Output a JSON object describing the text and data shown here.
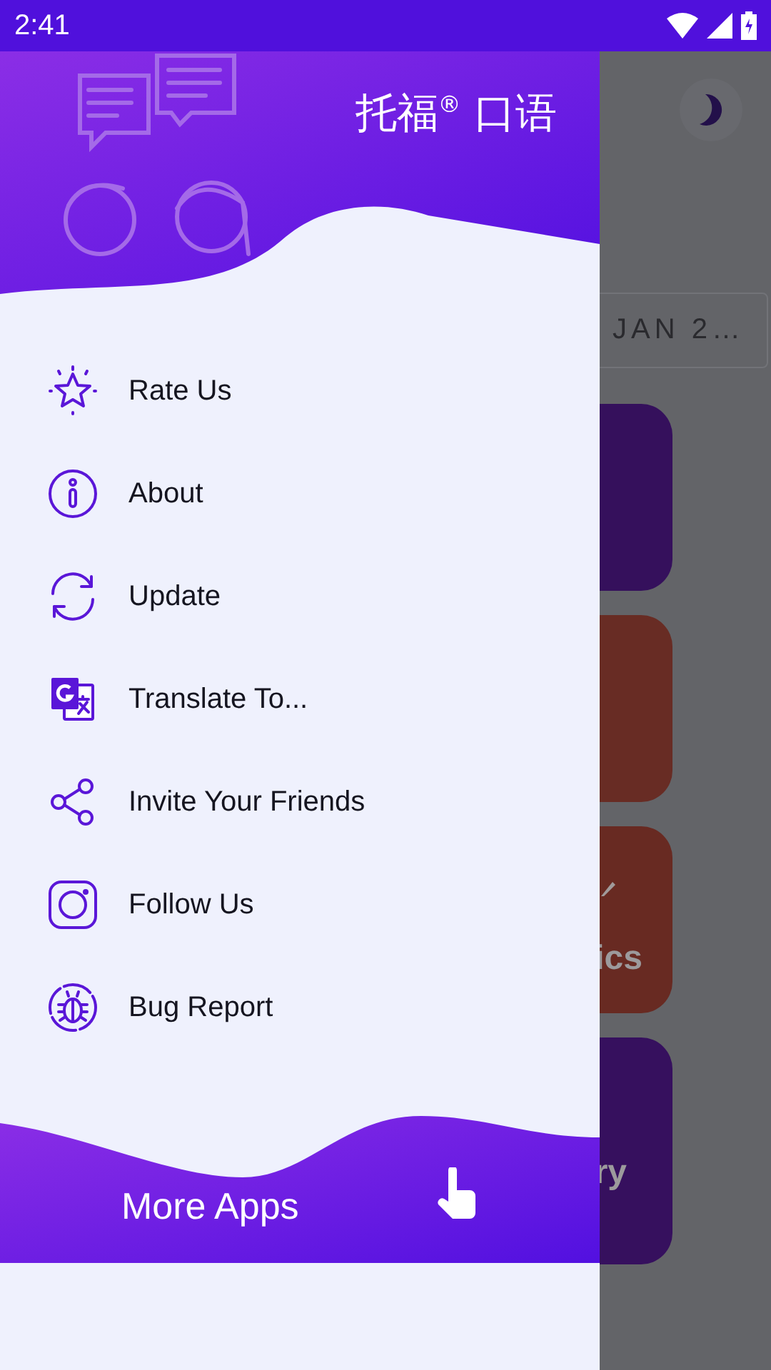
{
  "status_bar": {
    "time": "2:41"
  },
  "background": {
    "date_chip": "JAN 2…",
    "cards": [
      {
        "kind": "plain",
        "color": "#35105c"
      },
      {
        "kind": "plain",
        "color": "#682c24"
      },
      {
        "kind": "icon-label",
        "color": "#682a22",
        "label": "ics"
      },
      {
        "kind": "label",
        "color": "#36105e",
        "label": "ry"
      }
    ]
  },
  "drawer": {
    "title": "托福$^{®}$ 口语",
    "items": [
      {
        "kind": "star",
        "label": "Rate Us"
      },
      {
        "kind": "info",
        "label": "About"
      },
      {
        "kind": "refresh",
        "label": "Update"
      },
      {
        "kind": "translate",
        "label": "Translate To..."
      },
      {
        "kind": "share",
        "label": "Invite Your Friends"
      },
      {
        "kind": "camera",
        "label": "Follow Us"
      },
      {
        "kind": "bug",
        "label": "Bug Report"
      }
    ],
    "footer": {
      "label": "More Apps"
    }
  }
}
